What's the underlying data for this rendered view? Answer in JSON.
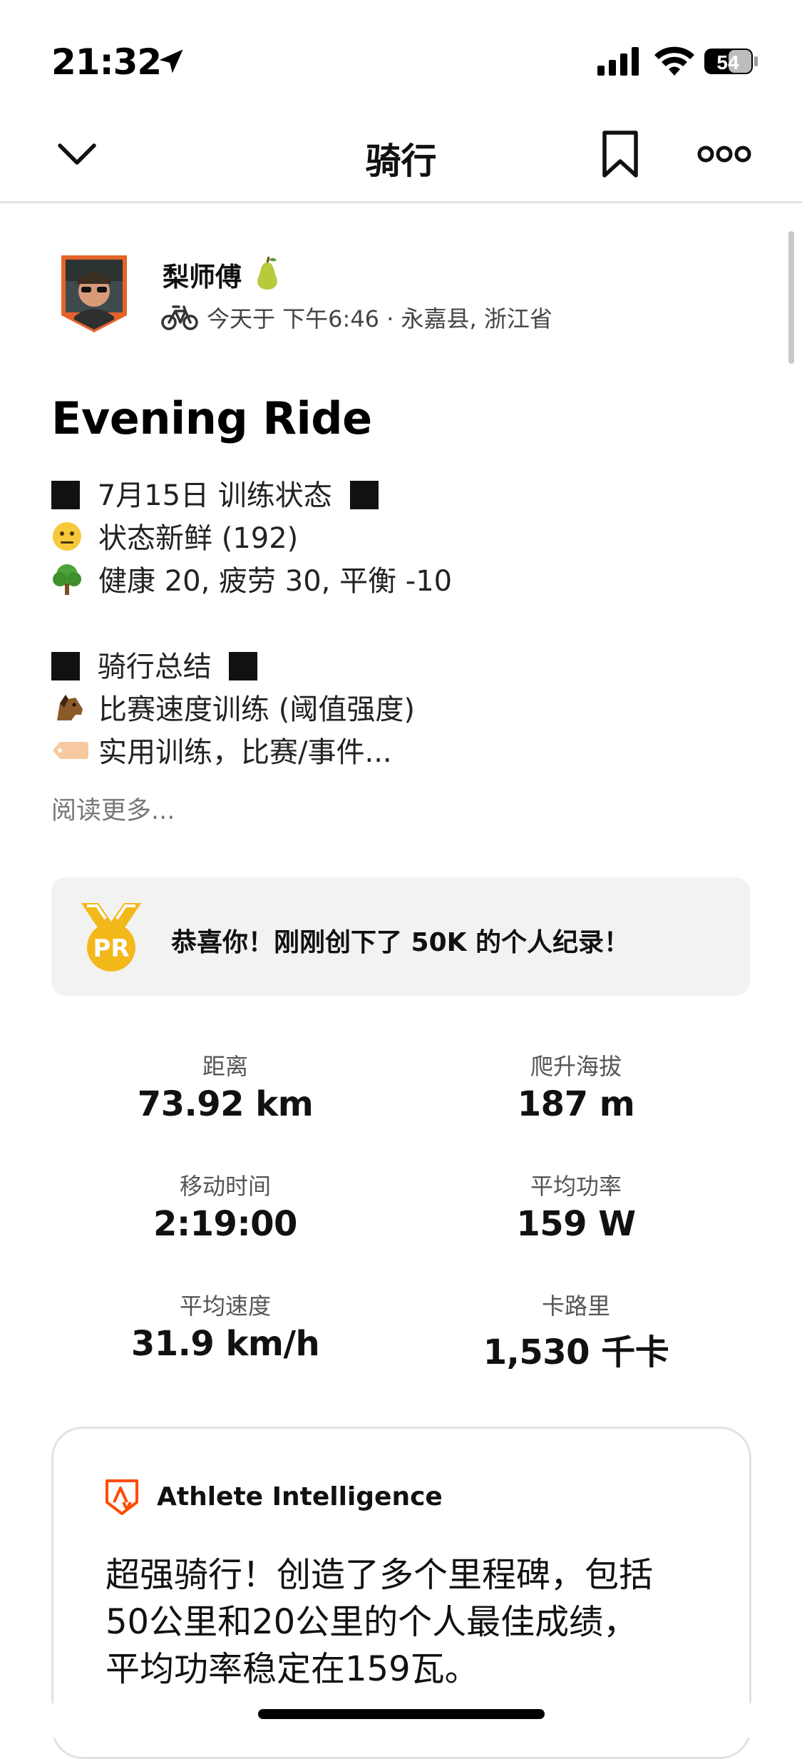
{
  "status": {
    "time": "21:32",
    "battery": "54"
  },
  "nav": {
    "title": "骑行"
  },
  "athlete": {
    "name": "梨师傅",
    "meta": "今天于 下午6:46 · 永嘉县, 浙江省"
  },
  "activity": {
    "title": "Evening Ride",
    "lines": [
      "7月15日 训练状态",
      "状态新鲜 (192)",
      "健康 20, 疲劳 30, 平衡 -10",
      "骑行总结",
      "比赛速度训练 (阈值强度)",
      "实用训练，比赛/事件..."
    ],
    "read_more": "阅读更多..."
  },
  "pr": {
    "text": "恭喜你！刚刚创下了 50K 的个人纪录！",
    "badge": "PR"
  },
  "stats": [
    {
      "label": "距离",
      "value": "73.92 km"
    },
    {
      "label": "爬升海拔",
      "value": "187 m"
    },
    {
      "label": "移动时间",
      "value": "2:19:00"
    },
    {
      "label": "平均功率",
      "value": "159 W"
    },
    {
      "label": "平均速度",
      "value": "31.9 km/h"
    },
    {
      "label": "卡路里",
      "value": "1,530 千卡"
    }
  ],
  "ai": {
    "title": "Athlete Intelligence",
    "lines": [
      "超强骑行！创造了多个里程碑，包括",
      "50公里和20公里的个人最佳成绩，",
      "平均功率稳定在159瓦。"
    ]
  },
  "icons": {
    "location": "location-arrow-icon",
    "signal": "cellular-signal-icon",
    "wifi": "wifi-icon",
    "battery": "battery-icon",
    "back": "chevron-down-icon",
    "bookmark": "bookmark-icon",
    "more": "more-icon",
    "bike": "bike-icon",
    "pear": "pear-emoji-icon",
    "medal": "pr-medal-icon",
    "ai": "strava-logo-icon"
  },
  "colors": {
    "accent": "#fc4c02",
    "pr_gold": "#f3b81a",
    "banner_bg": "#f2f2f0"
  }
}
